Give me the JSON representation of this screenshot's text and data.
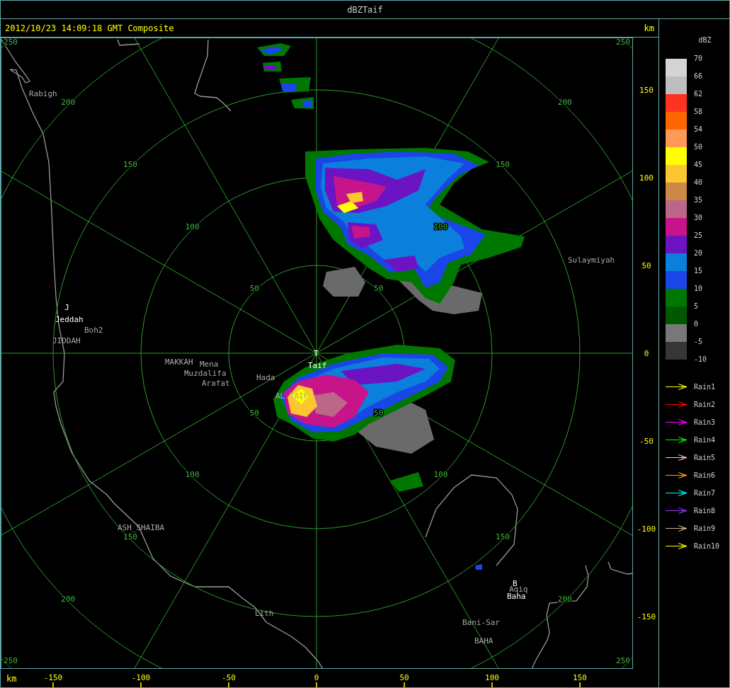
{
  "window": {
    "title": "dBZTaif"
  },
  "header": {
    "timestamp": "2012/10/23 14:09:18 GMT Composite",
    "unit": "km"
  },
  "map": {
    "range_rings": [
      {
        "labels": [
          "50",
          "50",
          "50",
          "50"
        ]
      },
      {
        "labels": [
          "100",
          "100",
          "100",
          "100"
        ]
      },
      {
        "labels": [
          "150",
          "150",
          "150",
          "150"
        ]
      },
      {
        "labels": [
          "200",
          "200",
          "200",
          "200"
        ]
      },
      {
        "labels": [
          "250",
          "250",
          "250",
          "250"
        ]
      }
    ],
    "places": [
      {
        "text": "Rabigh",
        "emphasized": false
      },
      {
        "text": "J",
        "emphasized": true
      },
      {
        "text": "Jeddah",
        "emphasized": true
      },
      {
        "text": "Boh2",
        "emphasized": false
      },
      {
        "text": "JIDDAH",
        "emphasized": false
      },
      {
        "text": "MAKKAH",
        "emphasized": false
      },
      {
        "text": "Mena",
        "emphasized": false
      },
      {
        "text": "Muzdalifa",
        "emphasized": false
      },
      {
        "text": "Arafat",
        "emphasized": false
      },
      {
        "text": "Hada",
        "emphasized": false
      },
      {
        "text": "T",
        "emphasized": true
      },
      {
        "text": "Taif",
        "emphasized": true
      },
      {
        "text": "AL TAIF",
        "emphasized": false
      },
      {
        "text": "Sulaymiyah",
        "emphasized": false
      },
      {
        "text": "ASH_SHAIBA",
        "emphasized": false
      },
      {
        "text": "Lith",
        "emphasized": false
      },
      {
        "text": "B",
        "emphasized": true
      },
      {
        "text": "Aqiq",
        "emphasized": false
      },
      {
        "text": "Baha",
        "emphasized": true
      },
      {
        "text": "Bani-Sar",
        "emphasized": false
      },
      {
        "text": "BAHA",
        "emphasized": false
      }
    ]
  },
  "y_axis": {
    "ticks": [
      "150",
      "100",
      "50",
      "0",
      "-50",
      "-100",
      "-150"
    ]
  },
  "x_axis": {
    "unit": "km",
    "ticks": [
      "-150",
      "-100",
      "-50",
      "0",
      "50",
      "100",
      "150"
    ]
  },
  "legend": {
    "title": "dBZ",
    "bins": [
      {
        "color": "#d4d4d4"
      },
      {
        "color": "#bebebe"
      },
      {
        "color": "#ff3322"
      },
      {
        "color": "#ff6600"
      },
      {
        "color": "#ff9955"
      },
      {
        "color": "#ffff00"
      },
      {
        "color": "#fcc630"
      },
      {
        "color": "#cc8844"
      },
      {
        "color": "#bc6688"
      },
      {
        "color": "#c8148a"
      },
      {
        "color": "#6c14c4"
      },
      {
        "color": "#0a80dc"
      },
      {
        "color": "#1a46e8"
      },
      {
        "color": "#007800"
      },
      {
        "color": "#005800"
      },
      {
        "color": "#787878"
      },
      {
        "color": "#363636"
      }
    ],
    "ticks": [
      "70",
      "66",
      "62",
      "58",
      "54",
      "50",
      "45",
      "40",
      "35",
      "30",
      "25",
      "20",
      "15",
      "10",
      "5",
      "0",
      "-5",
      "-10"
    ],
    "tracks": [
      {
        "label": "Rain1",
        "color": "#ffff00"
      },
      {
        "label": "Rain2",
        "color": "#ff0000"
      },
      {
        "label": "Rain3",
        "color": "#ff00ff"
      },
      {
        "label": "Rain4",
        "color": "#00ff00"
      },
      {
        "label": "Rain5",
        "color": "#ffc0cb"
      },
      {
        "label": "Rain6",
        "color": "#ffa500"
      },
      {
        "label": "Rain7",
        "color": "#00ffff"
      },
      {
        "label": "Rain8",
        "color": "#9933ff"
      },
      {
        "label": "Rain9",
        "color": "#d2b48c"
      },
      {
        "label": "Rain10",
        "color": "#ffff00"
      }
    ]
  }
}
